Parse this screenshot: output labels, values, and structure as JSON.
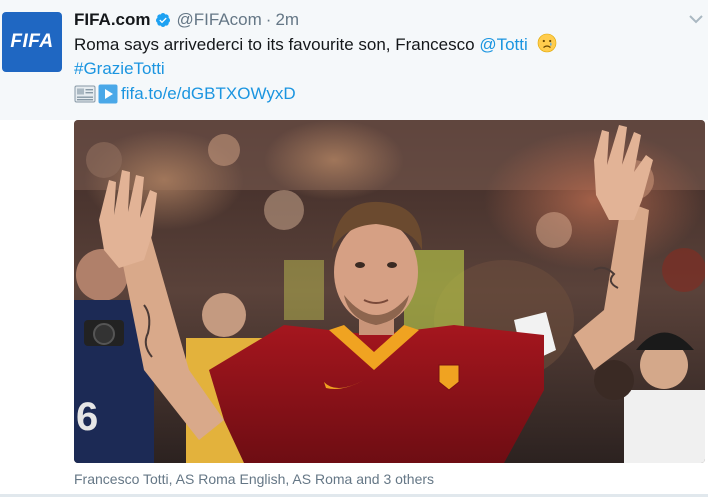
{
  "tweet": {
    "author_name": "FIFA.com",
    "handle": "@FIFAcom",
    "separator": "·",
    "time": "2m",
    "avatar_text": "FIFA",
    "text_main": "Roma says arrivederci to its favourite son, Francesco ",
    "mention": "@Totti",
    "hashtag": "#GrazieTotti",
    "link_text": "fifa.to/e/dGBTXOWyxD",
    "media_caption": "Francesco Totti, AS Roma English, AS Roma and 3 others"
  },
  "colors": {
    "link": "#1b95e0",
    "verified": "#1da1f2",
    "avatar_bg": "#1f67c2",
    "jersey": "#8b1219",
    "secondary_text": "#657786"
  },
  "icons": [
    "fifa-avatar",
    "verified-badge-icon",
    "chevron-down-icon",
    "sad-face-emoji-icon",
    "newspaper-icon",
    "play-button-icon"
  ]
}
